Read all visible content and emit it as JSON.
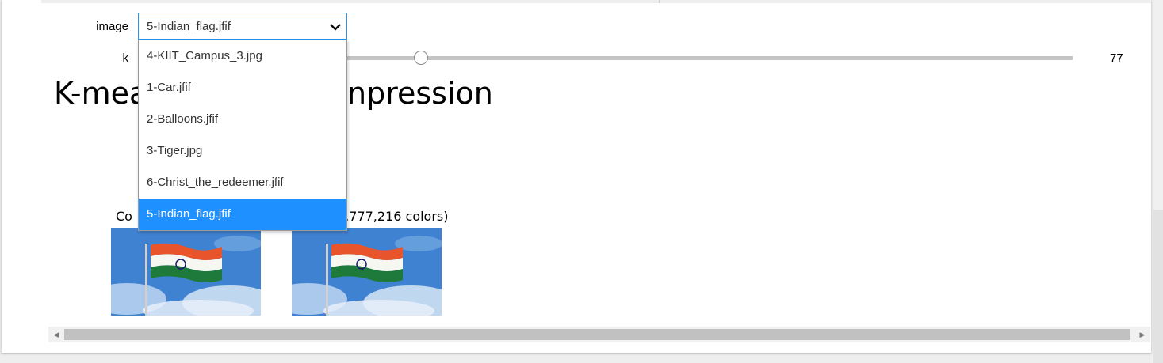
{
  "controls": {
    "image_label": "image",
    "image_selected": "5-Indian_flag.jfif",
    "image_options": [
      "4-KIIT_Campus_3.jpg",
      "1-Car.jfif",
      "2-Balloons.jfif",
      "3-Tiger.jpg",
      "6-Christ_the_redeemer.jfif",
      "5-Indian_flag.jfif"
    ],
    "k_label": "k",
    "k_value": "77"
  },
  "output": {
    "heading_left": "K-mea",
    "heading_right": "npression",
    "left_title_visible": "Co",
    "right_title_visible": "6,777,216 colors)"
  },
  "colors": {
    "accent": "#1e90ff",
    "select_border": "#2196f3",
    "flag_saffron": "#e8542b",
    "flag_green": "#138808",
    "sky": "#3d7fcf"
  },
  "icons": {
    "select_arrow": "chevron-down-icon",
    "scroll_left": "triangle-left-icon",
    "scroll_right": "triangle-right-icon"
  }
}
